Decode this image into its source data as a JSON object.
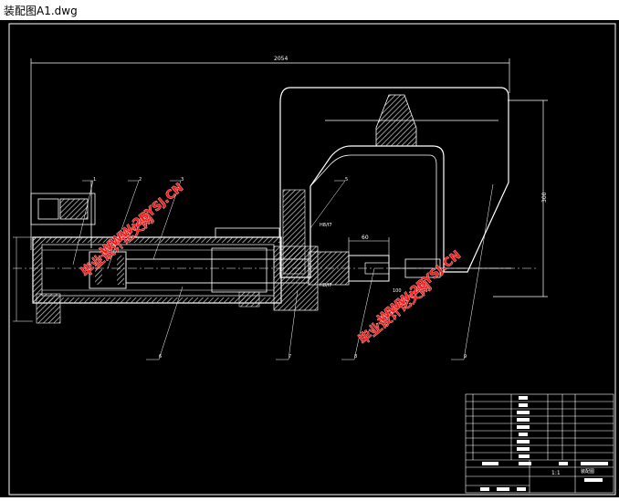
{
  "window": {
    "title": "装配图A1.dwg"
  },
  "drawing": {
    "dimension_overall": "2054",
    "dimension_height": "300",
    "dimension_shaft": "60",
    "dimension_small": "100",
    "part_labels": [
      "1",
      "2",
      "3",
      "4",
      "5",
      "6",
      "7",
      "8",
      "9"
    ],
    "fit_label": "H8/f7"
  },
  "title_block": {
    "scale_label": "1:1",
    "name_label": "装配图"
  },
  "watermarks": {
    "text_cn": "毕业设计论文网",
    "text_url": "WWW.2BYSJ.CN"
  },
  "colors": {
    "background": "#000000",
    "lines": "#ffffff",
    "hatch": "#cfcfcf",
    "watermark": "#ff1a1a"
  }
}
